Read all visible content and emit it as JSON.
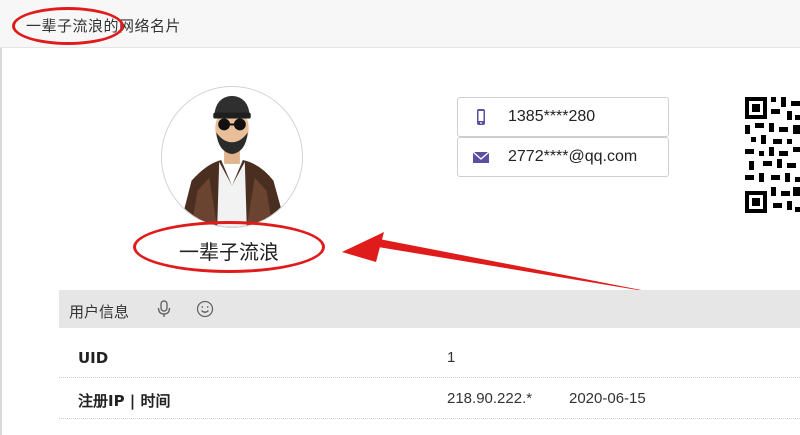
{
  "header": {
    "title": "一辈子流浪的网络名片"
  },
  "profile": {
    "name": "一辈子流浪"
  },
  "contacts": {
    "phone": "1385****280",
    "email": "2772****@qq.com"
  },
  "infobar": {
    "label": "用户信息",
    "icons": [
      "microphone-icon",
      "smile-icon"
    ]
  },
  "info_rows": [
    {
      "key": "UID",
      "value": "1",
      "extra": ""
    },
    {
      "key": "注册IP | 时间",
      "value": "218.90.222.*",
      "extra": "2020-06-15"
    }
  ],
  "colors": {
    "annotation": "#e01b1b",
    "contact_icon": "#5a4fa0",
    "bar": "#e6e6e6"
  }
}
